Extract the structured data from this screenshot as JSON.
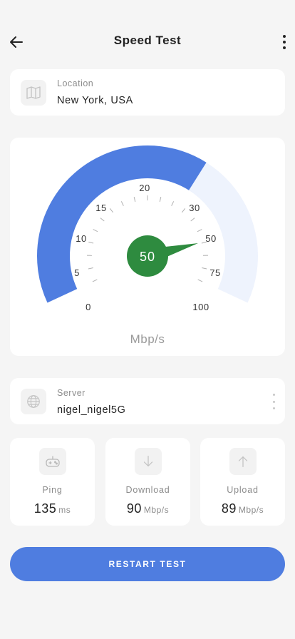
{
  "header": {
    "title": "Speed Test",
    "back_icon": "arrow-left-icon",
    "more_icon": "more-vertical-icon"
  },
  "location": {
    "icon": "map-icon",
    "label": "Location",
    "value": "New York, USA"
  },
  "gauge": {
    "current_value": "50",
    "unit": "Mbp/s",
    "scale_labels": [
      "0",
      "5",
      "10",
      "15",
      "20",
      "30",
      "50",
      "75",
      "100"
    ],
    "fill_fraction": 0.64,
    "colors": {
      "filled_arc": "#4f7de0",
      "empty_arc": "#eef3fd",
      "center": "#2e8b3f",
      "ticks": "#b0b0b0"
    }
  },
  "server": {
    "icon": "globe-icon",
    "label": "Server",
    "value": "nigel_nigel5G",
    "more_icon": "more-vertical-icon"
  },
  "stats": [
    {
      "icon": "gamepad-icon",
      "label": "Ping",
      "value": "135",
      "unit": "ms"
    },
    {
      "icon": "download-icon",
      "label": "Download",
      "value": "90",
      "unit": "Mbp/s"
    },
    {
      "icon": "upload-icon",
      "label": "Upload",
      "value": "89",
      "unit": "Mbp/s"
    }
  ],
  "actions": {
    "restart_label": "RESTART TEST"
  },
  "colors": {
    "accent": "#4f7de0",
    "background": "#f5f5f5"
  }
}
